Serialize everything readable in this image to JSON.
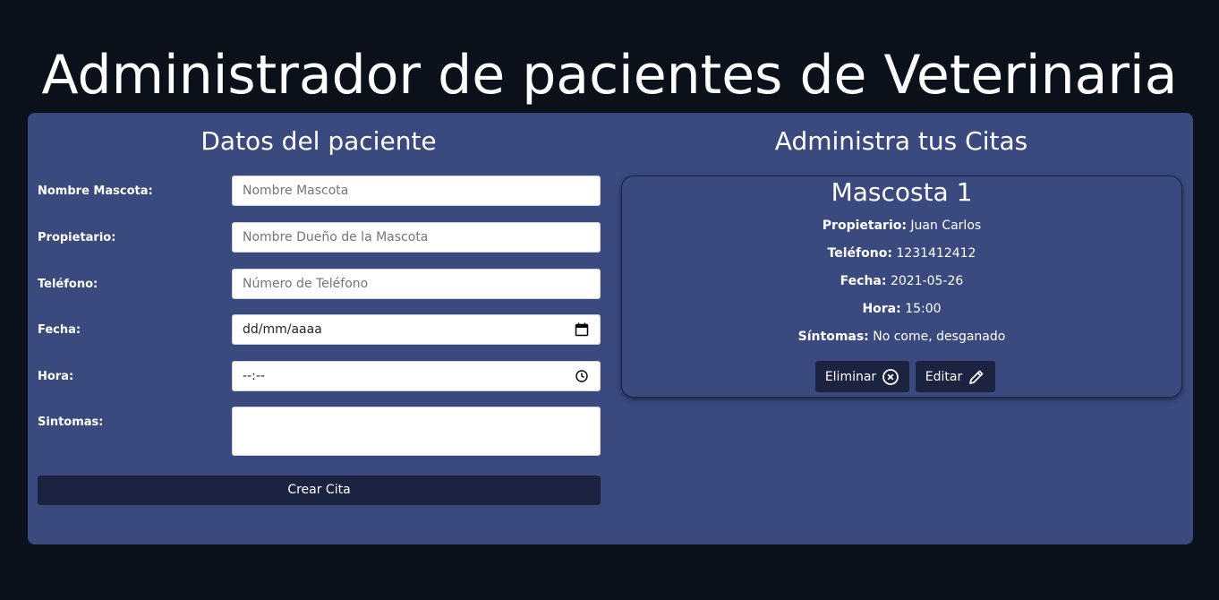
{
  "header": {
    "title": "Administrador de pacientes de Veterinaria"
  },
  "form": {
    "title": "Datos del paciente",
    "fields": [
      {
        "label": "Nombre Mascota:",
        "placeholder": "Nombre Mascota",
        "value": ""
      },
      {
        "label": "Propietario:",
        "placeholder": "Nombre Dueño de la Mascota",
        "value": ""
      },
      {
        "label": "Teléfono:",
        "placeholder": "Número de Teléfono",
        "value": ""
      },
      {
        "label": "Fecha:",
        "placeholder": "",
        "value": "dd/mm/aaaa"
      },
      {
        "label": "Hora:",
        "placeholder": "",
        "value": "--:--"
      },
      {
        "label": "Sintomas:",
        "placeholder": "",
        "value": ""
      }
    ],
    "submit_label": "Crear Cita"
  },
  "citas": {
    "title": "Administra tus Citas",
    "cards": [
      {
        "name": "Mascosta 1",
        "details": [
          {
            "label": "Propietario:",
            "value": "Juan Carlos"
          },
          {
            "label": "Teléfono:",
            "value": "1231412412"
          },
          {
            "label": "Fecha:",
            "value": "2021-05-26"
          },
          {
            "label": "Hora:",
            "value": "15:00"
          },
          {
            "label": "Síntomas:",
            "value": "No come, desganado"
          }
        ],
        "delete_label": "Eliminar",
        "edit_label": "Editar"
      }
    ]
  },
  "colors": {
    "background": "#0a111b",
    "panel": "#3a4a7f",
    "button": "#1b2340",
    "text": "#ffffff"
  },
  "icons": {
    "delete": "x-circle-icon",
    "edit": "pencil-icon",
    "date": "calendar-icon",
    "time": "clock-icon"
  }
}
